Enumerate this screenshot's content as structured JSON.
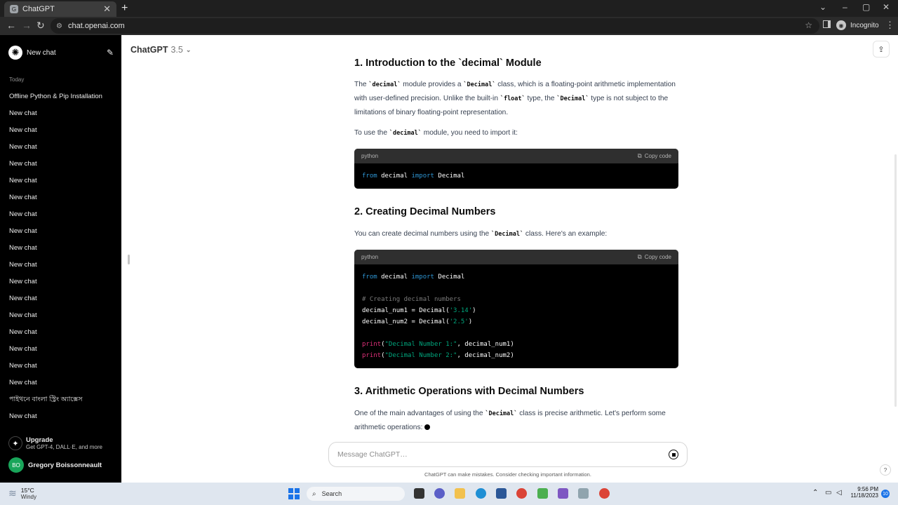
{
  "browser": {
    "tab_title": "ChatGPT",
    "tab_favicon": "G",
    "new_tab": "+",
    "url": "chat.openai.com",
    "profile_label": "Incognito",
    "min": "⌄",
    "restore": "–",
    "maximize": "▢",
    "close": "✕",
    "back": "←",
    "forward": "→",
    "reload": "↻",
    "star": "☆",
    "menu": "⋮"
  },
  "sidebar": {
    "new_chat_label": "New chat",
    "section_label": "Today",
    "chats": [
      "Offline Python & Pip Installation",
      "New chat",
      "New chat",
      "New chat",
      "New chat",
      "New chat",
      "New chat",
      "New chat",
      "New chat",
      "New chat",
      "New chat",
      "New chat",
      "New chat",
      "New chat",
      "New chat",
      "New chat",
      "New chat",
      "New chat",
      "পাইথনে বাংলা স্ট্রিং অ্যাক্সেস",
      "New chat"
    ],
    "upgrade_title": "Upgrade",
    "upgrade_subtitle": "Get GPT-4, DALL·E, and more",
    "user_initials": "BO",
    "user_name": "Gregory Boissonneault"
  },
  "header": {
    "model_name": "ChatGPT",
    "model_version": "3.5"
  },
  "content": {
    "heading1_cut": "1. Introduction to the `decimal` Module",
    "p1": {
      "t1": "The ",
      "c1": "`decimal`",
      "t2": " module provides a ",
      "c2": "`Decimal`",
      "t3": " class, which is a floating-point arithmetic implementation with user-defined precision. Unlike the built-in ",
      "c3": "`float`",
      "t4": " type, the ",
      "c4": "`Decimal`",
      "t5": " type is not subject to the limitations of binary floating-point representation."
    },
    "p2": {
      "t1": "To use the ",
      "c1": "`decimal`",
      "t2": " module, you need to import it:"
    },
    "code1": {
      "lang": "python",
      "copy_label": "Copy code",
      "l1_kw1": "from",
      "l1_mod": " decimal ",
      "l1_kw2": "import",
      "l1_name": " Decimal"
    },
    "heading2": "2. Creating Decimal Numbers",
    "p3": {
      "t1": "You can create decimal numbers using the ",
      "c1": "`Decimal`",
      "t2": " class. Here's an example:"
    },
    "code2": {
      "lang": "python",
      "copy_label": "Copy code",
      "l1_kw1": "from",
      "l1_mod": " decimal ",
      "l1_kw2": "import",
      "l1_name": " Decimal",
      "l3_comment": "# Creating decimal numbers",
      "l4_a": "decimal_num1 = Decimal(",
      "l4_s": "'3.14'",
      "l4_b": ")",
      "l5_a": "decimal_num2 = Decimal(",
      "l5_s": "'2.5'",
      "l5_b": ")",
      "l7_fn": "print",
      "l7_a": "(",
      "l7_s": "\"Decimal Number 1:\"",
      "l7_b": ", decimal_num1)",
      "l8_fn": "print",
      "l8_a": "(",
      "l8_s": "\"Decimal Number 2:\"",
      "l8_b": ", decimal_num2)"
    },
    "heading3": "3. Arithmetic Operations with Decimal Numbers",
    "p4": {
      "t1": "One of the main advantages of using the ",
      "c1": "`Decimal`",
      "t2": " class is precise arithmetic. Let's perform some arithmetic operations:"
    }
  },
  "composer": {
    "placeholder": "Message ChatGPT…",
    "disclaimer": "ChatGPT can make mistakes. Consider checking important information.",
    "help": "?"
  },
  "taskbar": {
    "temperature": "15°C",
    "condition": "Windy",
    "search_label": "Search",
    "time": "9:56 PM",
    "date": "11/18/2023",
    "notifications": "10"
  },
  "icons": {
    "edit": "edit-icon",
    "share": "share-icon",
    "copy": "copy-icon",
    "stop": "stop-icon"
  }
}
